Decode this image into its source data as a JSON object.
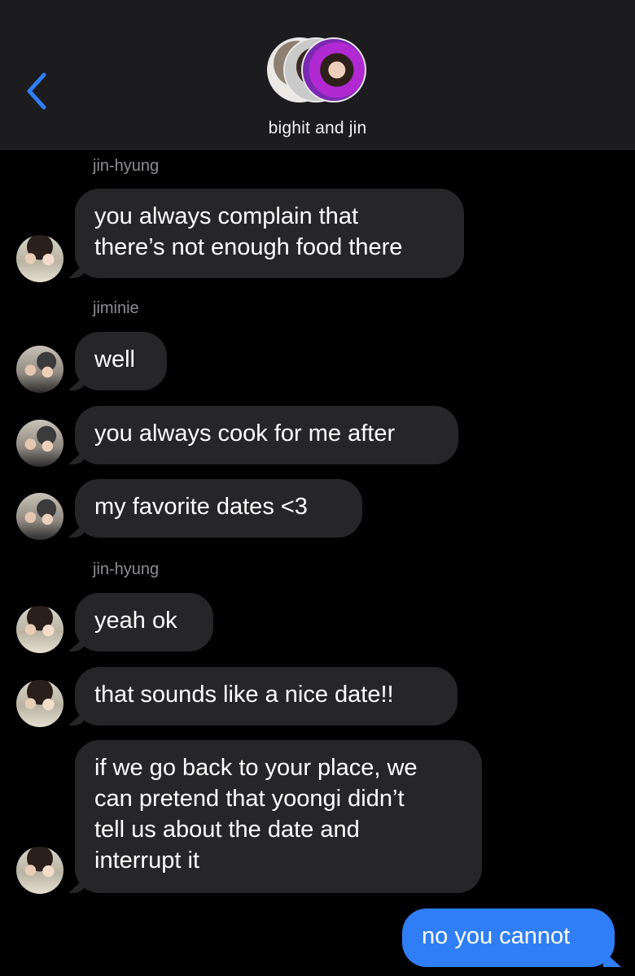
{
  "header": {
    "group_name": "bighit and jin"
  },
  "messages": [
    {
      "sender": "jin-hyung",
      "lines": [
        "you always complain that",
        "there’s not enough food there"
      ]
    },
    {
      "sender": "jiminie",
      "lines": [
        "well"
      ]
    },
    {
      "lines": [
        "you always cook for me after"
      ]
    },
    {
      "lines": [
        "my favorite dates <3"
      ]
    },
    {
      "sender": "jin-hyung",
      "lines": [
        "yeah ok"
      ]
    },
    {
      "lines": [
        "that sounds like a nice date!!"
      ]
    },
    {
      "lines": [
        "if we go back to your place, we",
        "can pretend that yoongi didn’t",
        "tell us about the date and",
        "interrupt it"
      ]
    }
  ],
  "outgoing": {
    "text": "no you cannot"
  },
  "colors": {
    "header_bg": "#1c1c1e",
    "incoming_bubble": "#262628",
    "outgoing_bubble": "#2f7ef6",
    "back_chevron": "#2f7ef6",
    "sender_label": "#8e8e93"
  },
  "icons": {
    "back": "chevron-left-icon"
  }
}
